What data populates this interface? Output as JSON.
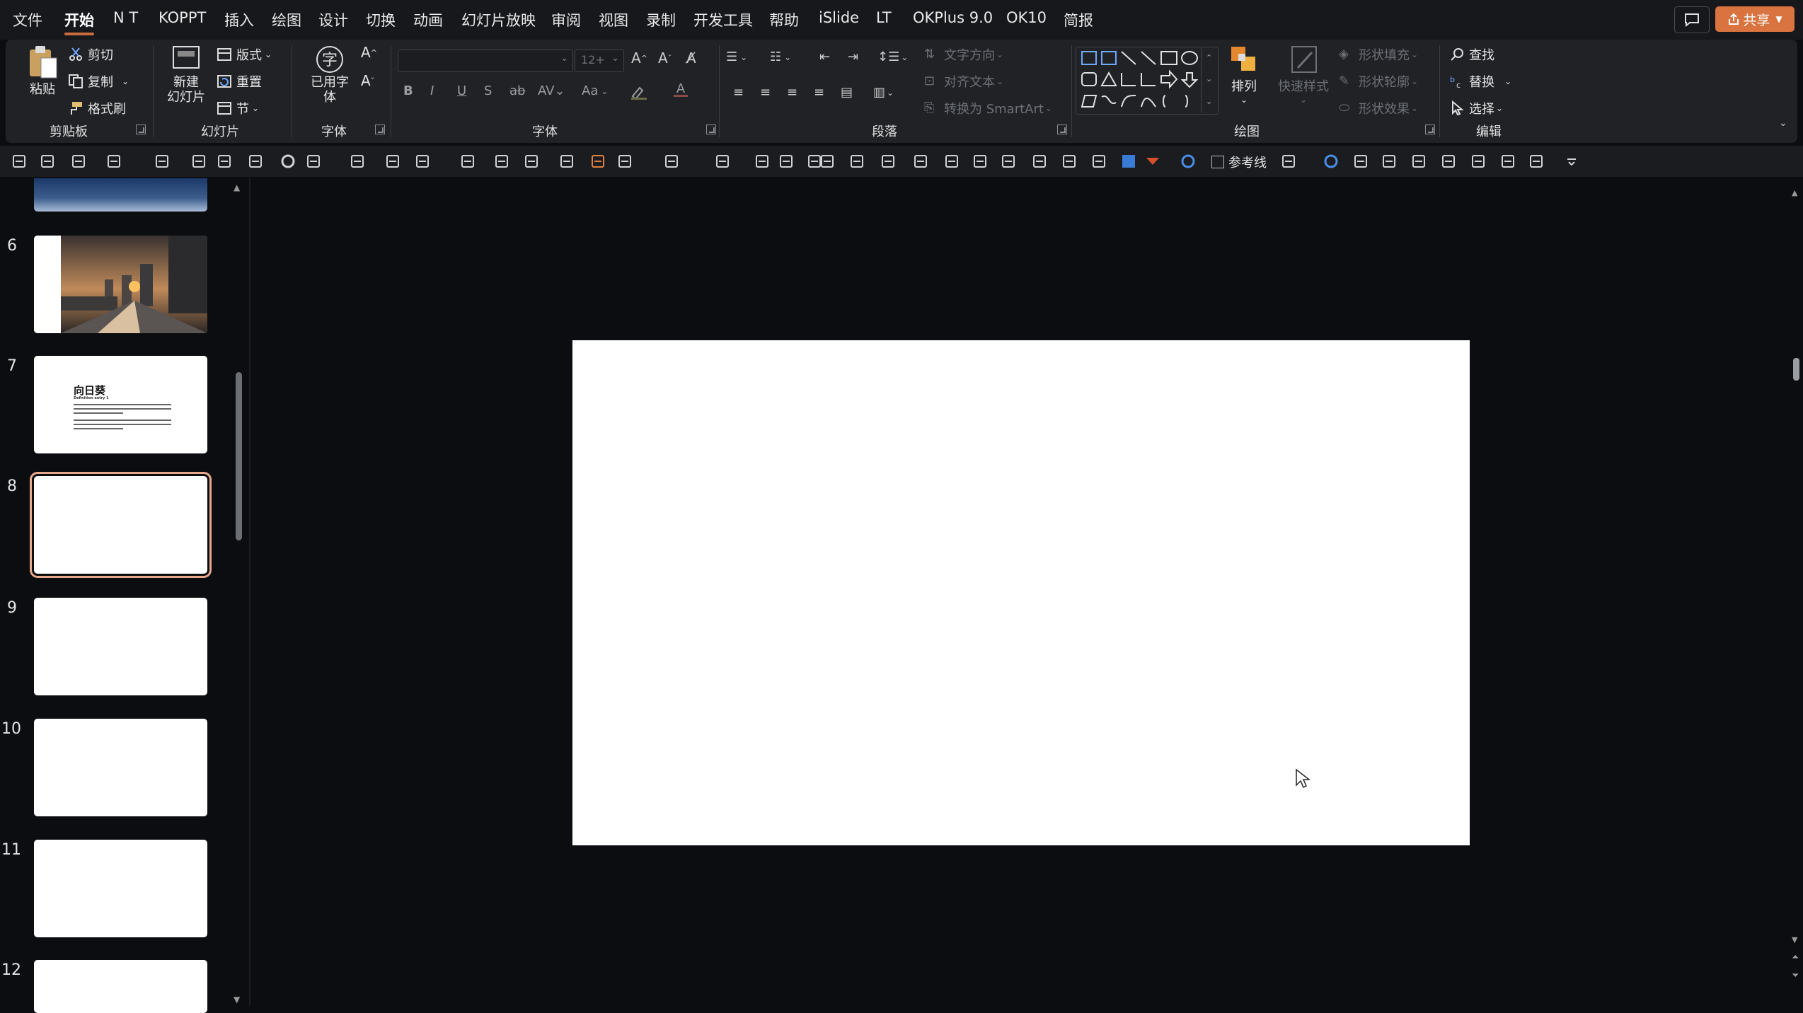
{
  "menu": {
    "items": [
      "文件",
      "开始",
      "N T",
      "KOPPT",
      "插入",
      "绘图",
      "设计",
      "切换",
      "动画",
      "幻灯片放映",
      "审阅",
      "视图",
      "录制",
      "开发工具",
      "帮助",
      "iSlide",
      "LT",
      "OKPlus 9.0",
      "OK10",
      "简报"
    ],
    "active": "开始",
    "share": "共享"
  },
  "ribbon": {
    "clipboard": {
      "paste": "粘贴",
      "cut": "剪切",
      "copy": "复制",
      "format_painter": "格式刷",
      "label": "剪贴板"
    },
    "slides": {
      "new_slide_line1": "新建",
      "new_slide_line2": "幻灯片",
      "layout": "版式",
      "reset": "重置",
      "section": "节",
      "label": "幻灯片"
    },
    "used_font": {
      "line1": "已用字",
      "line2": "体",
      "label": "字体"
    },
    "font": {
      "font_size": "12+",
      "change_case": "Aa",
      "label": "字体"
    },
    "paragraph": {
      "text_direction": "文字方向",
      "align_text": "对齐文本",
      "convert_smartart": "转换为 SmartArt",
      "label": "段落"
    },
    "drawing": {
      "arrange": "排列",
      "quick_styles": "快速样式",
      "shape_fill": "形状填充",
      "shape_outline": "形状轮廓",
      "shape_effects": "形状效果",
      "label": "绘图"
    },
    "editing": {
      "find": "查找",
      "replace": "替换",
      "select": "选择",
      "label": "编辑"
    }
  },
  "qat": {
    "guides_label": "参考线"
  },
  "thumbnails": [
    {
      "num": "6",
      "kind": "city"
    },
    {
      "num": "7",
      "kind": "text",
      "title": "向日葵",
      "subtitle": "Definition entry 1"
    },
    {
      "num": "8",
      "kind": "blank",
      "selected": true
    },
    {
      "num": "9",
      "kind": "blank"
    },
    {
      "num": "10",
      "kind": "blank"
    },
    {
      "num": "11",
      "kind": "blank"
    },
    {
      "num": "12",
      "kind": "blank"
    }
  ],
  "colors": {
    "accent": "#c96b3c",
    "share_btn": "#d9733f",
    "selected_outline": "#e8a98c"
  }
}
